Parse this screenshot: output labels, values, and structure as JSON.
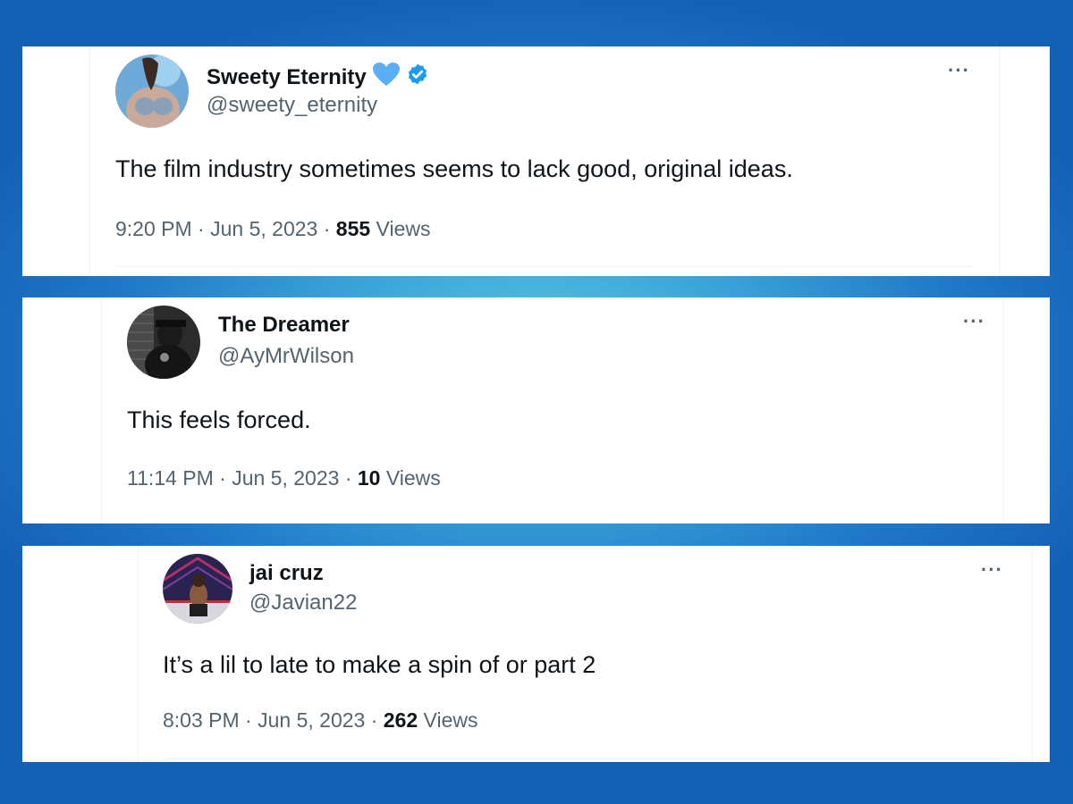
{
  "colors": {
    "background_center": "#58c8e0",
    "background_edge": "#1460b5",
    "verified_badge": "#1d9bf0",
    "heart_badge": "#5aaef5",
    "text_primary": "#0f1419",
    "text_secondary": "#536471"
  },
  "tweets": [
    {
      "display_name": "Sweety Eternity",
      "handle": "@sweety_eternity",
      "badges": [
        "blue-heart-icon",
        "verified-badge-icon"
      ],
      "text": "The film industry sometimes seems to lack good, original ideas.",
      "time": "9:20 PM",
      "sep1": "·",
      "date": "Jun 5, 2023",
      "sep2": "·",
      "views_count": "855",
      "views_label": "Views",
      "more": "···"
    },
    {
      "display_name": "The Dreamer",
      "handle": "@AyMrWilson",
      "badges": [],
      "text": "This feels forced.",
      "time": "11:14 PM",
      "sep1": "·",
      "date": "Jun 5, 2023",
      "sep2": "·",
      "views_count": "10",
      "views_label": "Views",
      "more": "···"
    },
    {
      "display_name": "jai cruz",
      "handle": "@Javian22",
      "badges": [],
      "text": "It’s a lil to late to make a spin of or part 2",
      "time": "8:03 PM",
      "sep1": "·",
      "date": "Jun 5, 2023",
      "sep2": "·",
      "views_count": "262",
      "views_label": "Views",
      "more": "···"
    }
  ]
}
